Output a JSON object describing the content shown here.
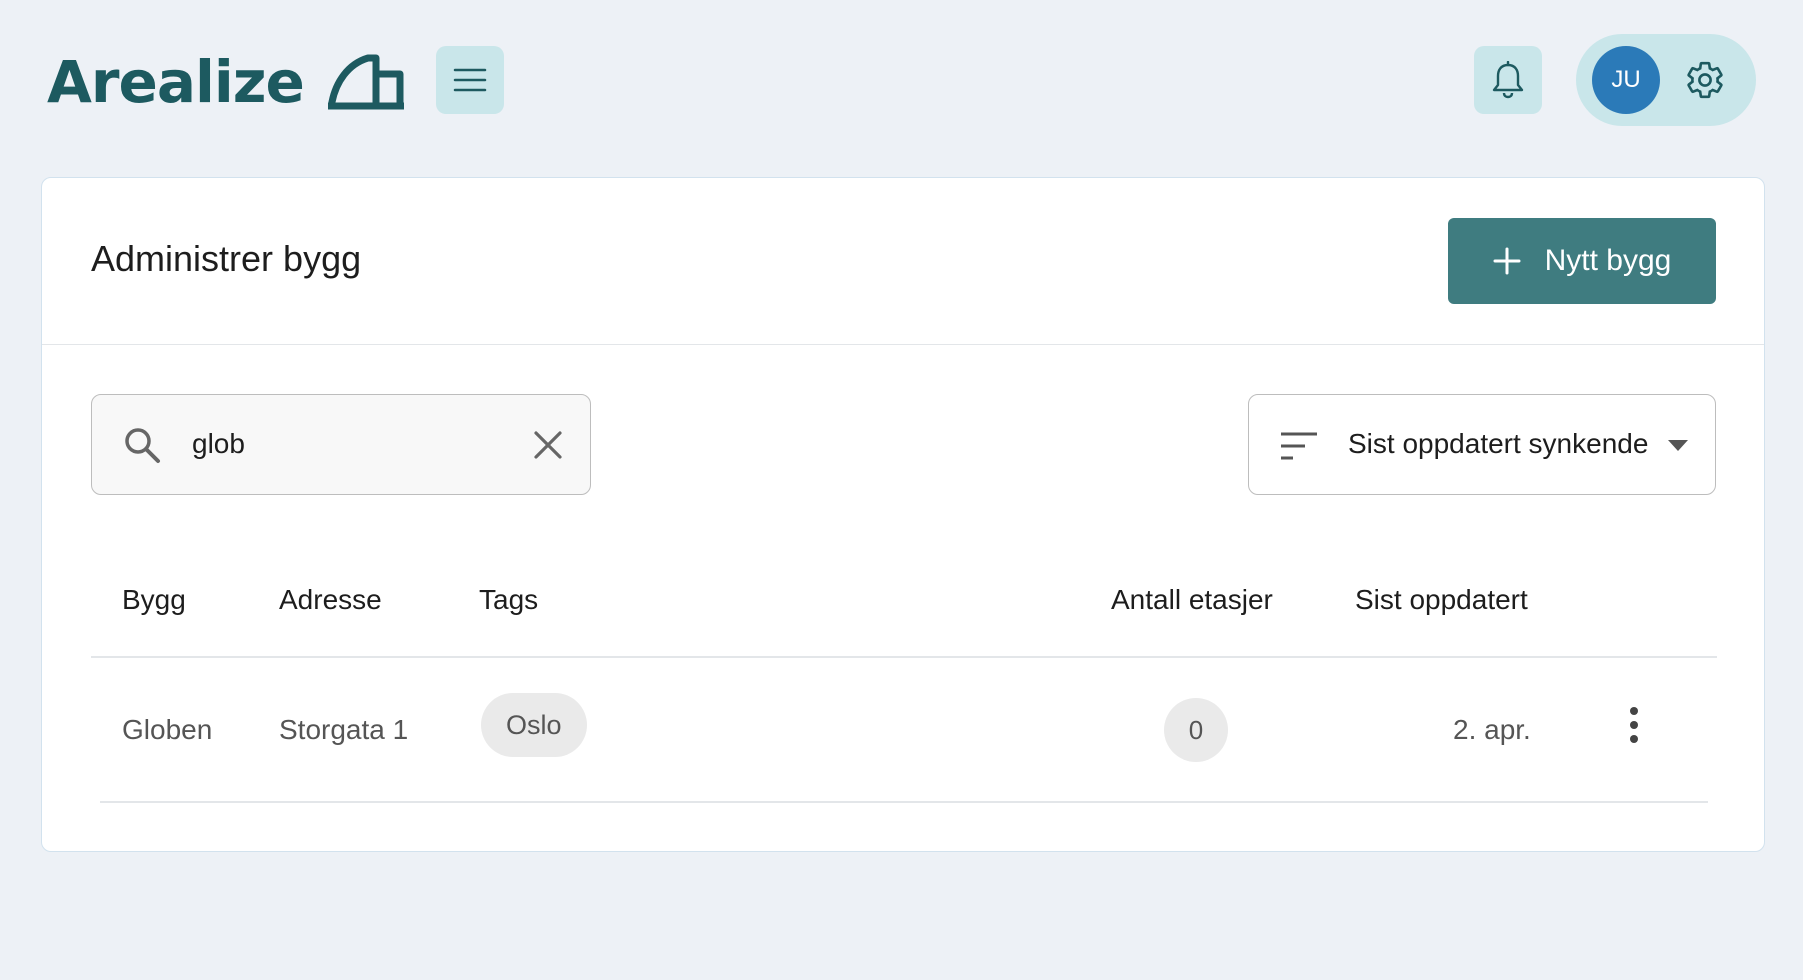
{
  "header": {
    "logo_text": "Arealize",
    "avatar_initials": "JU",
    "icons": {
      "menu": "hamburger-icon",
      "notifications": "bell-icon",
      "settings": "gear-icon"
    },
    "colors": {
      "brand": "#1d5a60",
      "header_button_bg": "#c9e6ea",
      "avatar_bg": "#2b7ab8"
    }
  },
  "main": {
    "title": "Administrer bygg",
    "new_button_label": "Nytt bygg",
    "search": {
      "value": "glob"
    },
    "sort": {
      "selected": "Sist oppdatert synkende"
    },
    "table": {
      "columns": [
        "Bygg",
        "Adresse",
        "Tags",
        "Antall etasjer",
        "Sist oppdatert"
      ],
      "rows": [
        {
          "name": "Globen",
          "address": "Storgata 1",
          "tags": [
            "Oslo"
          ],
          "floors": "0",
          "updated": "2. apr."
        }
      ]
    },
    "colors": {
      "primary_button": "#3f7c80"
    }
  }
}
